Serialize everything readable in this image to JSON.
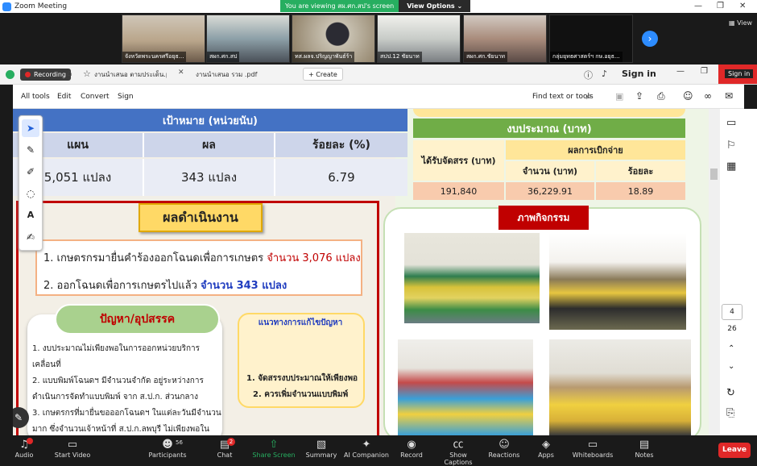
{
  "app": {
    "title": "Zoom Meeting",
    "banner_text": "You are viewing สผ.ศก.สป's screen",
    "view_options": "View Options",
    "view": "View"
  },
  "participants": [
    {
      "name": "จังหวัดพระนครศรีอยุธ..."
    },
    {
      "name": "สผก.ศก.สป"
    },
    {
      "name": "ทส.ผลจ.ปริญญาพันธ์ร้า"
    },
    {
      "name": "สปป.12 ชัยนาท"
    },
    {
      "name": "สผก.ศก.ชัยนาท"
    },
    {
      "name": "กลุ่มยุทธศาสตร์ฯ กษ.อยุธ..."
    }
  ],
  "acrobat": {
    "recording": "Recording",
    "tabs": [
      "งานนำเสนอ ตามประเด็น.pdf",
      "งานนำเสนอ รวม .pdf"
    ],
    "create": "Create",
    "sign_in": "Sign in",
    "sign_in_tip": "Sign in",
    "menu": [
      "All tools",
      "Edit",
      "Convert",
      "Sign"
    ],
    "find": "Find text or tools",
    "page_current": "4",
    "page_total": "26"
  },
  "slide": {
    "target": {
      "title": "เป้าหมาย (หน่วยนับ)",
      "headers": [
        "แผน",
        "ผล",
        "ร้อยละ (%)"
      ],
      "values": [
        "5,051 แปลง",
        "343 แปลง",
        "6.79"
      ]
    },
    "budget": {
      "title": "งบประมาณ (บาท)",
      "received": "ได้รับจัดสรร (บาท)",
      "disbursed": "ผลการเบิกจ่าย",
      "amount": "จำนวน (บาท)",
      "percent": "ร้อยละ",
      "values": [
        "191,840",
        "36,229.91",
        "18.89"
      ]
    },
    "results": {
      "title": "ผลดำเนินงาน",
      "line1": "1. เกษตรกรมายื่นคำร้องออกโฉนดเพื่อการเกษตร ",
      "line1_hl": "จำนวน 3,076 แปลง",
      "line2": "2. ออกโฉนดเพื่อการเกษตรไปแล้ว ",
      "line2_hl": "จำนวน 343 แปลง"
    },
    "problems": {
      "title": "ปัญหา/อุปสรรค",
      "items": [
        "1. งบประมาณไม่เพียงพอในการออกหน่วยบริการ",
        "เคลื่อนที่",
        "2. แบบพิมพ์โฉนดฯ มีจำนวนจำกัด อยู่ระหว่างการ",
        "ดำเนินการจัดทำแบบพิมพ์ จาก ส.ป.ก. ส่วนกลาง",
        "3. เกษตรกรที่มายื่นขอออกโฉนดฯ ในแต่ละวันมีจำนวน",
        "มาก ซึ่งจำนวนเจ้าหน้าที่ ส.ป.ก.ลพบุรี ไม่เพียงพอใน"
      ]
    },
    "solutions": {
      "title": "แนวทางการแก้ไขปัญหา",
      "items": [
        "1. จัดสรรงบประมาณให้เพียงพอ",
        "2. ควรเพิ่มจำนวนแบบพิมพ์"
      ]
    },
    "activities": {
      "title": "ภาพกิจกรรม"
    }
  },
  "zoom_controls": [
    "Audio",
    "Start Video",
    "Participants",
    "Chat",
    "Share Screen",
    "Summary",
    "AI Companion",
    "Record",
    "Show Captions",
    "Reactions",
    "Apps",
    "Whiteboards",
    "Notes"
  ],
  "participants_count": "56",
  "chat_badge": "2",
  "leave": "Leave",
  "colors": {
    "accent": "#2d8cff",
    "share_green": "#27ae60",
    "leave_red": "#e02828",
    "slide_blue": "#4472c4",
    "slide_green": "#70ad47",
    "slide_orange": "#f4b183"
  }
}
